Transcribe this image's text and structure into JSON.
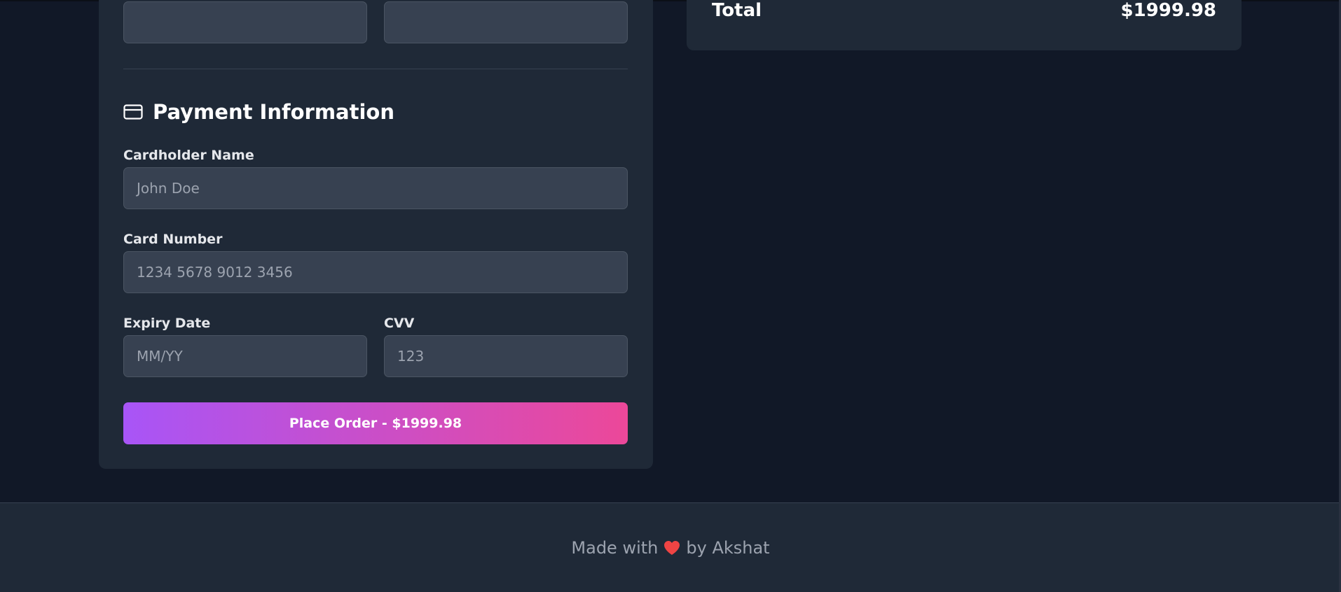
{
  "shipping": {
    "field_left_value": "",
    "field_right_value": ""
  },
  "payment": {
    "title": "Payment Information",
    "icon": "credit-card-icon",
    "cardholder_label": "Cardholder Name",
    "cardholder_placeholder": "John Doe",
    "card_number_label": "Card Number",
    "card_number_placeholder": "1234 5678 9012 3456",
    "expiry_label": "Expiry Date",
    "expiry_placeholder": "MM/YY",
    "cvv_label": "CVV",
    "cvv_placeholder": "123",
    "place_order_label": "Place Order - $1999.98"
  },
  "summary": {
    "total_label": "Total",
    "total_value": "$1999.98"
  },
  "footer": {
    "made_with": "Made with",
    "by": "by Akshat",
    "heart_icon": "heart-icon"
  },
  "colors": {
    "background": "#111827",
    "card": "#1f2937",
    "input": "#374151",
    "gradient_start": "#a855f7",
    "gradient_end": "#ec4899",
    "heart": "#ef4444"
  }
}
